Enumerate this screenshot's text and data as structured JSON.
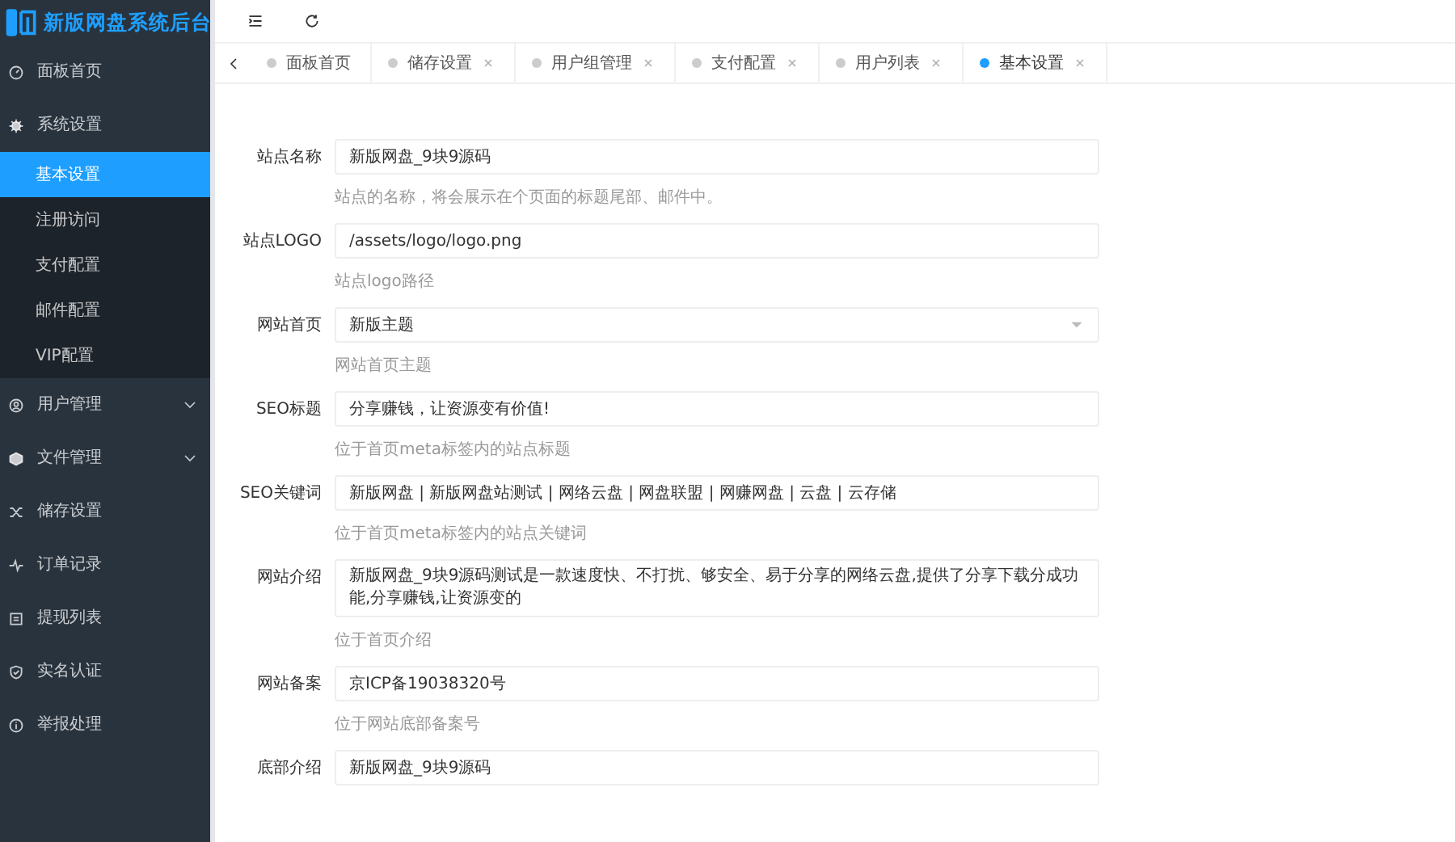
{
  "app": {
    "title": "新版网盘系统后台"
  },
  "sidebar": {
    "items": [
      {
        "label": "面板首页",
        "kind": "gauge",
        "selected": false
      },
      {
        "label": "系统设置",
        "kind": "gear",
        "selected": false,
        "expanded": true,
        "children": [
          {
            "label": "基本设置",
            "selected": true
          },
          {
            "label": "注册访问",
            "selected": false
          },
          {
            "label": "支付配置",
            "selected": false
          },
          {
            "label": "邮件配置",
            "selected": false
          },
          {
            "label": "VIP配置",
            "selected": false
          }
        ]
      },
      {
        "label": "用户管理",
        "kind": "user",
        "selected": false,
        "expanded": false
      },
      {
        "label": "文件管理",
        "kind": "box",
        "selected": false,
        "expanded": false
      },
      {
        "label": "储存设置",
        "kind": "shuffle",
        "selected": false
      },
      {
        "label": "订单记录",
        "kind": "pulse",
        "selected": false
      },
      {
        "label": "提现列表",
        "kind": "list",
        "selected": false
      },
      {
        "label": "实名认证",
        "kind": "shield",
        "selected": false
      },
      {
        "label": "举报处理",
        "kind": "info",
        "selected": false
      }
    ]
  },
  "tabs": [
    {
      "label": "面板首页",
      "selected": false,
      "closable": false
    },
    {
      "label": "储存设置",
      "selected": false,
      "closable": true
    },
    {
      "label": "用户组管理",
      "selected": false,
      "closable": true
    },
    {
      "label": "支付配置",
      "selected": false,
      "closable": true
    },
    {
      "label": "用户列表",
      "selected": false,
      "closable": true
    },
    {
      "label": "基本设置",
      "selected": true,
      "closable": true
    }
  ],
  "form": {
    "fields": [
      {
        "label": "站点名称",
        "kind": "text",
        "value": "新版网盘_9块9源码",
        "hint": "站点的名称，将会展示在个页面的标题尾部、邮件中。"
      },
      {
        "label": "站点LOGO",
        "kind": "text",
        "value": "/assets/logo/logo.png",
        "hint": "站点logo路径"
      },
      {
        "label": "网站首页",
        "kind": "select",
        "value": "新版主题",
        "hint": "网站首页主题"
      },
      {
        "label": "SEO标题",
        "kind": "text",
        "value": "分享赚钱，让资源变有价值!",
        "hint": "位于首页meta标签内的站点标题"
      },
      {
        "label": "SEO关键词",
        "kind": "text",
        "value": "新版网盘 | 新版网盘站测试 | 网络云盘 | 网盘联盟 | 网赚网盘 | 云盘 | 云存储",
        "hint": "位于首页meta标签内的站点关键词"
      },
      {
        "label": "网站介绍",
        "kind": "textarea",
        "value": "新版网盘_9块9源码测试是一款速度快、不打扰、够安全、易于分享的网络云盘,提供了分享下载分成功能,分享赚钱,让资源变的",
        "hint": "位于首页介绍"
      },
      {
        "label": "网站备案",
        "kind": "text",
        "value": "京ICP备19038320号",
        "hint": "位于网站底部备案号"
      },
      {
        "label": "底部介绍",
        "kind": "text",
        "value": "新版网盘_9块9源码"
      }
    ]
  }
}
